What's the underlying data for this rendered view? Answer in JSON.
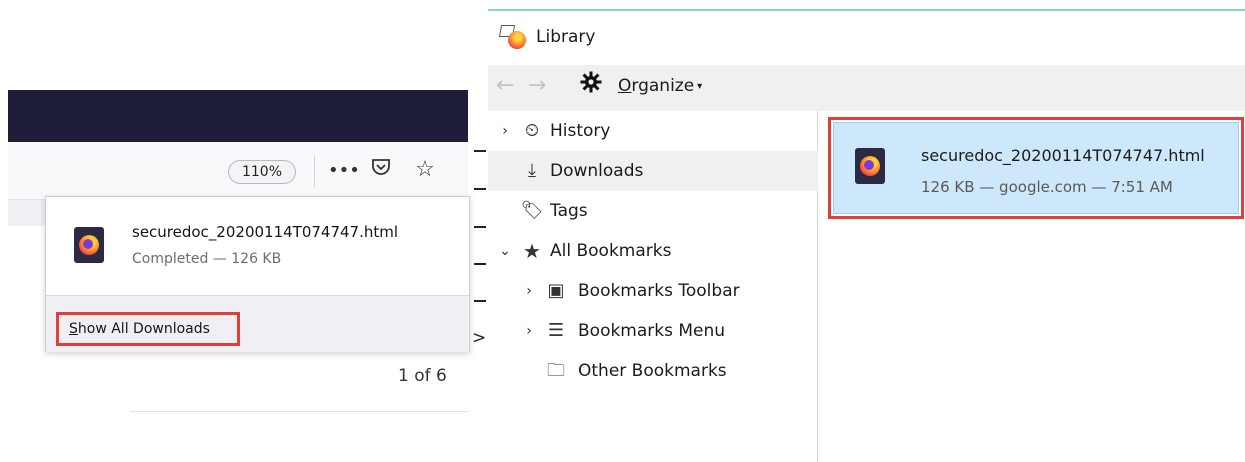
{
  "left_panel": {
    "zoom_label": "110%",
    "toolbar_icons": {
      "more": "•••",
      "pocket": "☐",
      "star": "☆"
    },
    "download": {
      "filename": "securedoc_20200114T074747.html",
      "status": "Completed — 126 KB"
    },
    "show_all_label_underlined": "S",
    "show_all_label_rest": "how All Downloads",
    "page_count": "1 of 6"
  },
  "connector": {
    "arrow": ">"
  },
  "library": {
    "title": "Library",
    "organize_underlined": "O",
    "organize_rest": "rganize",
    "organize_caret": "▾",
    "nav": {
      "back": "←",
      "forward": "→"
    },
    "sidebar": [
      {
        "label": "History",
        "twisty": "›",
        "icon": "clock-icon",
        "glyph": "⏲",
        "selected": false
      },
      {
        "label": "Downloads",
        "twisty": "",
        "icon": "download-icon",
        "glyph": "⤓",
        "selected": true
      },
      {
        "label": "Tags",
        "twisty": "",
        "icon": "tag-icon",
        "glyph": "🏷",
        "selected": false
      },
      {
        "label": "All Bookmarks",
        "twisty": "⌄",
        "icon": "star-icon",
        "glyph": "★",
        "selected": false
      },
      {
        "label": "Bookmarks Toolbar",
        "twisty": "›",
        "icon": "bookmarks-toolbar-icon",
        "glyph": "▣",
        "selected": false
      },
      {
        "label": "Bookmarks Menu",
        "twisty": "›",
        "icon": "bookmarks-menu-icon",
        "glyph": "☰",
        "selected": false
      },
      {
        "label": "Other Bookmarks",
        "twisty": "",
        "icon": "folder-icon",
        "glyph": "🗀",
        "selected": false
      }
    ],
    "item": {
      "filename": "securedoc_20200114T074747.html",
      "meta": "126 KB — google.com — 7:51 AM"
    }
  },
  "colors": {
    "titlebar": "#1f1e3a",
    "highlight_border": "#e0403a",
    "selected_item_bg": "#cde8fb",
    "library_top_border": "#8cd4c8"
  }
}
